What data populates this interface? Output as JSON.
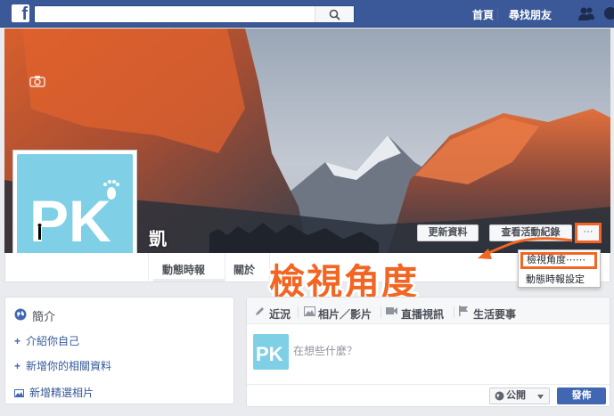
{
  "topbar": {
    "logo": "f",
    "search_placeholder": "",
    "nav_home": "首頁",
    "nav_find_friends": "尋找朋友",
    "icons": [
      "search-icon",
      "friends-icon",
      "messages-icon"
    ]
  },
  "profile": {
    "name": "凱",
    "avatar_text": "PK"
  },
  "cover_buttons": {
    "update_info": "更新資料",
    "activity_log": "查看活動紀錄",
    "more": "···"
  },
  "tabs": [
    "動態時報",
    "關於"
  ],
  "dropdown": {
    "items": [
      "檢視角度⋯⋯",
      "動態時報設定"
    ]
  },
  "annotation": "檢視角度",
  "intro": {
    "title": "簡介",
    "links": [
      "介紹你自己",
      "新增你的相關資料",
      "新增精選相片"
    ]
  },
  "composer": {
    "tabs": [
      "近況",
      "相片／影片",
      "直播視訊",
      "生活要事"
    ],
    "placeholder": "在想些什麼？",
    "privacy": "公開",
    "post": "發佈"
  },
  "colors": {
    "facebook_blue": "#3b5998",
    "highlight_orange": "#f26522",
    "avatar_bg": "#7fd0e6"
  }
}
